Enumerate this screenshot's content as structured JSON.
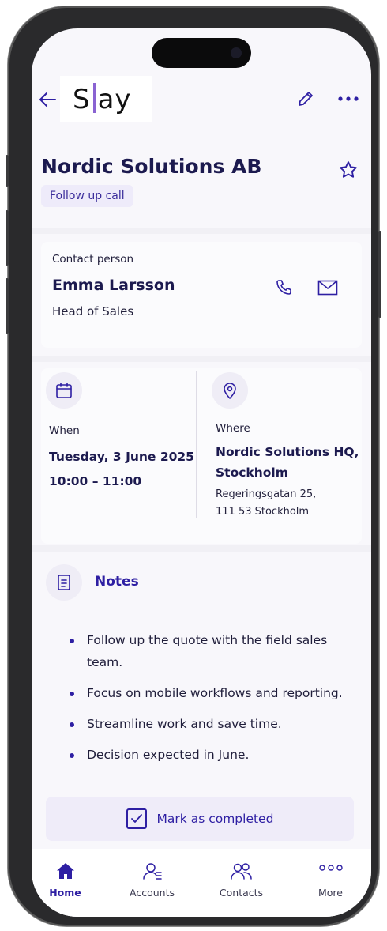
{
  "header": {
    "logo_text_left": "S",
    "logo_text_right": "ay"
  },
  "meeting": {
    "title": "Nordic Solutions AB",
    "tag": "Follow up call"
  },
  "contact": {
    "label": "Contact person",
    "name": "Emma Larsson",
    "role": "Head of Sales"
  },
  "when": {
    "label": "When",
    "date": "Tuesday, 3 June 2025",
    "time": "10:00 – 11:00"
  },
  "where": {
    "label": "Where",
    "place_line1": "Nordic Solutions HQ,",
    "place_line2": "Stockholm",
    "address_line1": "Regeringsgatan 25,",
    "address_line2": "111 53 Stockholm"
  },
  "notes": {
    "title": "Notes",
    "items": [
      "Follow up the quote with the field sales team.",
      "Focus on mobile workflows and reporting.",
      "Streamline work and save time.",
      "Decision expected in June."
    ]
  },
  "actions": {
    "mark_completed": "Mark as completed"
  },
  "tabs": [
    {
      "label": "Home",
      "icon": "home-icon",
      "active": true
    },
    {
      "label": "Accounts",
      "icon": "accounts-icon",
      "active": false
    },
    {
      "label": "Contacts",
      "icon": "contacts-icon",
      "active": false
    },
    {
      "label": "More",
      "icon": "more-icon",
      "active": false
    }
  ],
  "colors": {
    "accent": "#2e1fa3",
    "title": "#1c1a4f",
    "tag_bg": "#eeebfa",
    "background": "#f8f7fb"
  }
}
